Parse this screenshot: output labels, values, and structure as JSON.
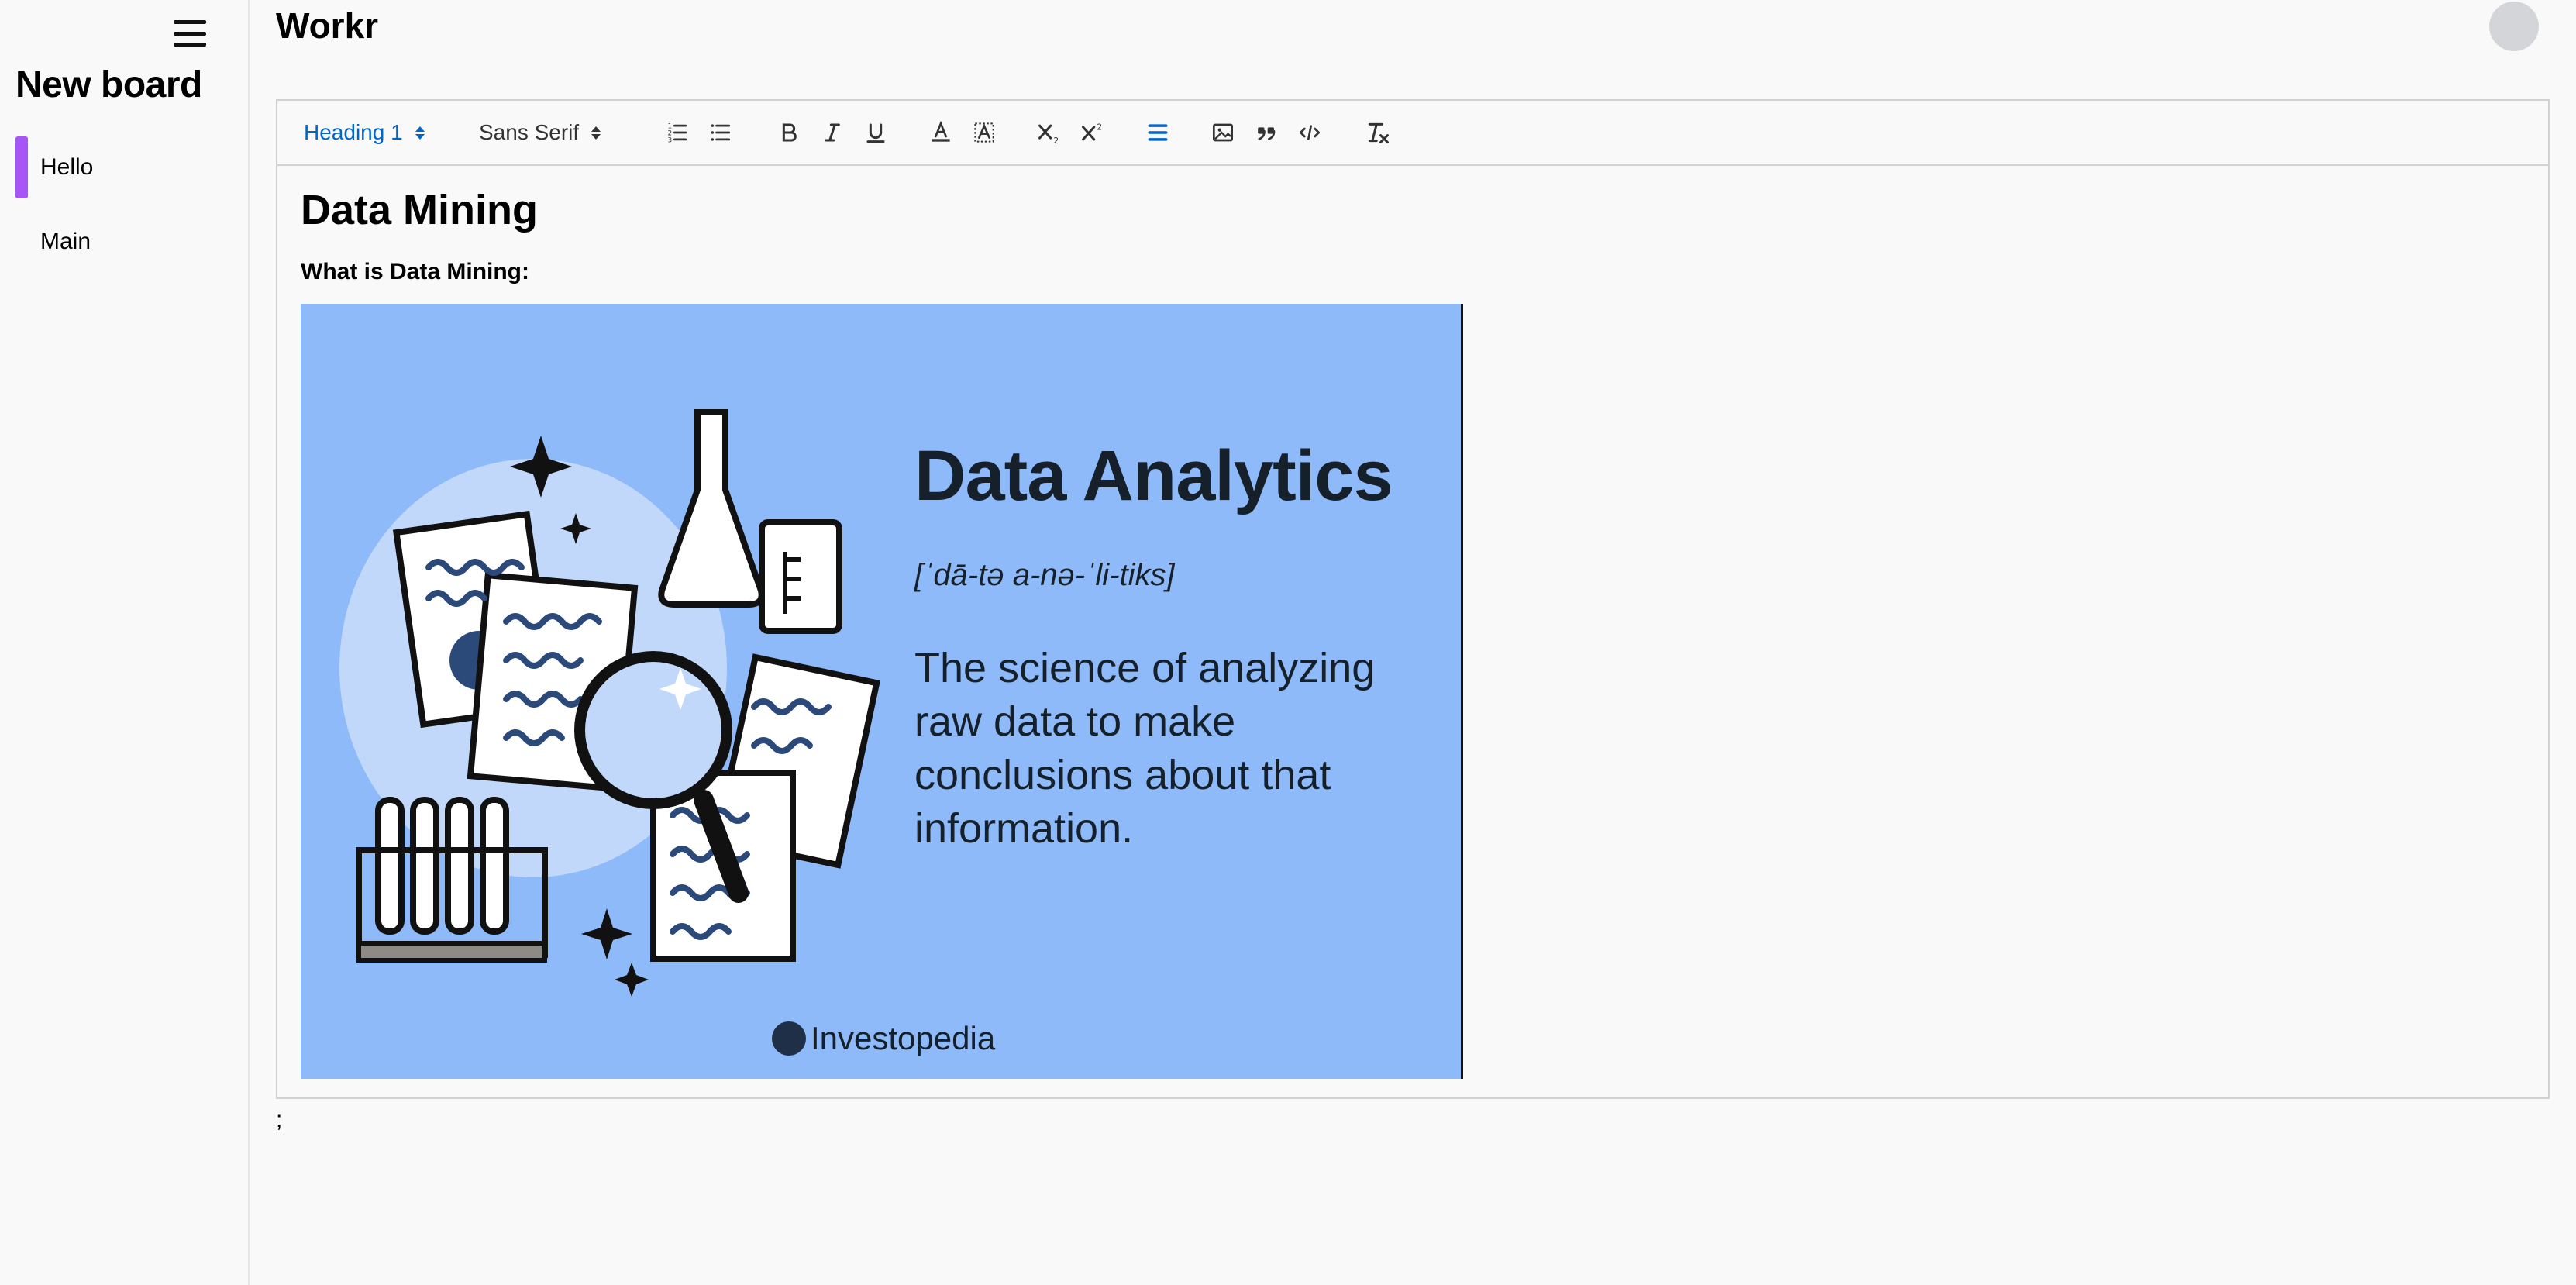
{
  "app": {
    "title": "Workr"
  },
  "sidebar": {
    "board_title": "New board",
    "items": [
      {
        "label": "Hello",
        "active": true
      },
      {
        "label": "Main",
        "active": false
      }
    ]
  },
  "toolbar": {
    "heading_picker": "Heading 1",
    "font_picker": "Sans Serif",
    "active_color": "#0066cc",
    "buttons": [
      "ordered-list",
      "bullet-list",
      "bold",
      "italic",
      "underline",
      "font-color",
      "background-color",
      "subscript",
      "superscript",
      "align",
      "image",
      "blockquote",
      "code-block",
      "clean-formatting"
    ]
  },
  "document": {
    "heading": "Data Mining",
    "subheading": "What is Data Mining:",
    "image": {
      "title": "Data Analytics",
      "pronunciation": "[ˈdā-tə a-nə-ˈli-tiks]",
      "description": "The science of analyzing raw data to make conclusions about that information.",
      "brand": "Investopedia",
      "background": "#8fbaf9"
    }
  },
  "after_editor_text": ";"
}
